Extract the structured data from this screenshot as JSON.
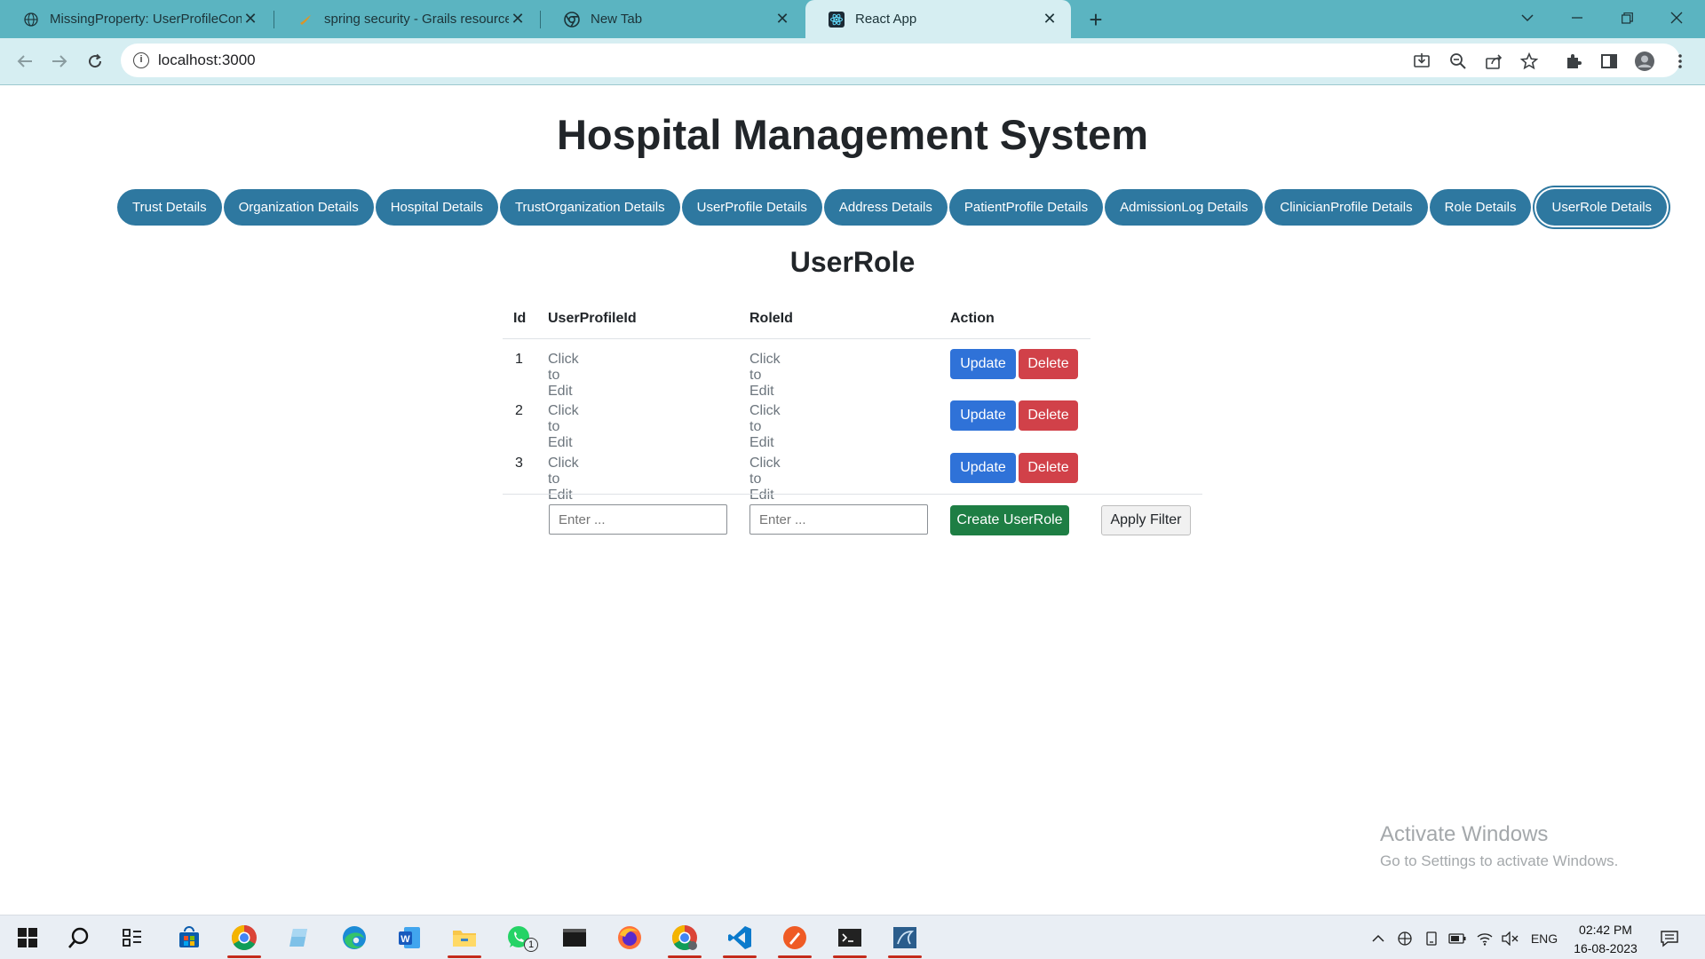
{
  "browser": {
    "tabs": [
      {
        "title": "MissingProperty: UserProfileCont",
        "icon": "globe-icon"
      },
      {
        "title": "spring security - Grails resources",
        "icon": "grails-icon"
      },
      {
        "title": "New Tab",
        "icon": "chrome-icon"
      },
      {
        "title": "React App",
        "icon": "react-icon",
        "active": true
      }
    ],
    "url": "localhost:3000"
  },
  "page": {
    "title": "Hospital Management System",
    "nav": [
      "Trust Details",
      "Organization Details",
      "Hospital Details",
      "TrustOrganization Details",
      "UserProfile Details",
      "Address Details",
      "PatientProfile Details",
      "AdmissionLog Details",
      "ClinicianProfile Details",
      "Role Details",
      "UserRole Details"
    ],
    "active_nav": "UserRole Details",
    "section_title": "UserRole",
    "table": {
      "headers": [
        "Id",
        "UserProfileId",
        "RoleId",
        "Action"
      ],
      "rows": [
        {
          "id": "1",
          "user_profile_id": "Click to Edit",
          "role_id": "Click to Edit"
        },
        {
          "id": "2",
          "user_profile_id": "Click to Edit",
          "role_id": "Click to Edit"
        },
        {
          "id": "3",
          "user_profile_id": "Click to Edit",
          "role_id": "Click to Edit"
        }
      ],
      "update_label": "Update",
      "delete_label": "Delete"
    },
    "form": {
      "user_profile_placeholder": "Enter ...",
      "role_placeholder": "Enter ...",
      "create_label": "Create UserRole",
      "filter_label": "Apply Filter"
    }
  },
  "watermark": {
    "line1": "Activate Windows",
    "line2": "Go to Settings to activate Windows."
  },
  "taskbar": {
    "language": "ENG",
    "time": "02:42 PM",
    "date": "16-08-2023",
    "whatsapp_badge": "1"
  },
  "colors": {
    "tabbar": "#5bb4c1",
    "toolbar": "#d6eef2",
    "pill": "#2e78a0",
    "update": "#2f72d8",
    "delete": "#d14149",
    "create": "#1e7e44"
  }
}
